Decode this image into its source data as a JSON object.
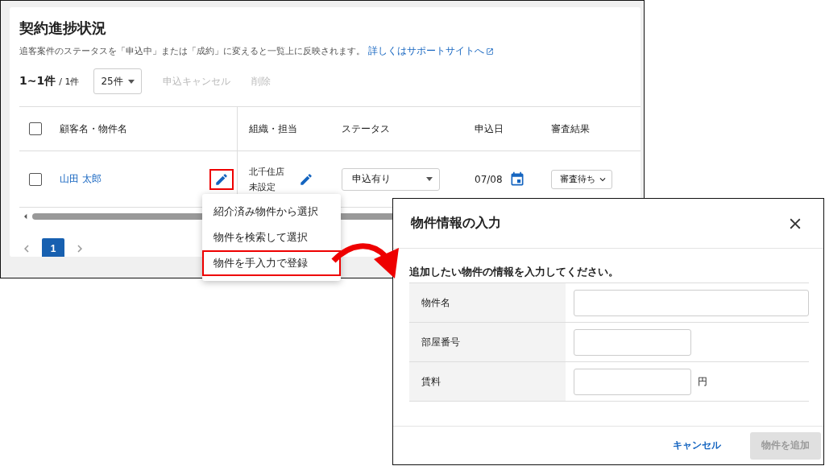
{
  "list_screen": {
    "title": "契約進捗状況",
    "description": "追客案件のステータスを「申込中」または「成約」に変えると一覧上に反映されます。",
    "help_link": "詳しくはサポートサイトへ",
    "count": "1~1件",
    "total": "/ 1件",
    "page_size": "25件",
    "actions": [
      {
        "label": "申込キャンセル",
        "disabled": true
      },
      {
        "label": "削除",
        "disabled": true
      }
    ],
    "table": {
      "header_checked": false,
      "columns": [
        "顧客名・物件名",
        "組織・担当",
        "ステータス",
        "申込日",
        "審査結果"
      ],
      "rows": [
        {
          "checked": false,
          "customer": "山田 太郎",
          "edit_highlighted": true,
          "store": "北千住店",
          "staff": "未設定",
          "status": "申込有り",
          "date": "07/08",
          "review": "審査待ち"
        }
      ]
    },
    "pagination": [
      {
        "label": "1",
        "selected": true
      }
    ],
    "menu": [
      {
        "label": "紹介済み物件から選択",
        "highlighted": false
      },
      {
        "label": "物件を検索して選択",
        "highlighted": false
      },
      {
        "label": "物件を手入力で登録",
        "highlighted": true
      }
    ]
  },
  "dialog": {
    "title": "物件情報の入力",
    "instruction": "追加したい物件の情報を入力してください。",
    "fields": [
      {
        "label": "物件名",
        "kind": "wide"
      },
      {
        "label": "部屋番号",
        "kind": "short"
      },
      {
        "label": "賃料",
        "kind": "short",
        "unit": "円"
      }
    ],
    "buttons": [
      {
        "label": "キャンセル",
        "kind": "text",
        "disabled": false
      },
      {
        "label": "物件を追加",
        "kind": "filled",
        "disabled": true
      }
    ]
  }
}
